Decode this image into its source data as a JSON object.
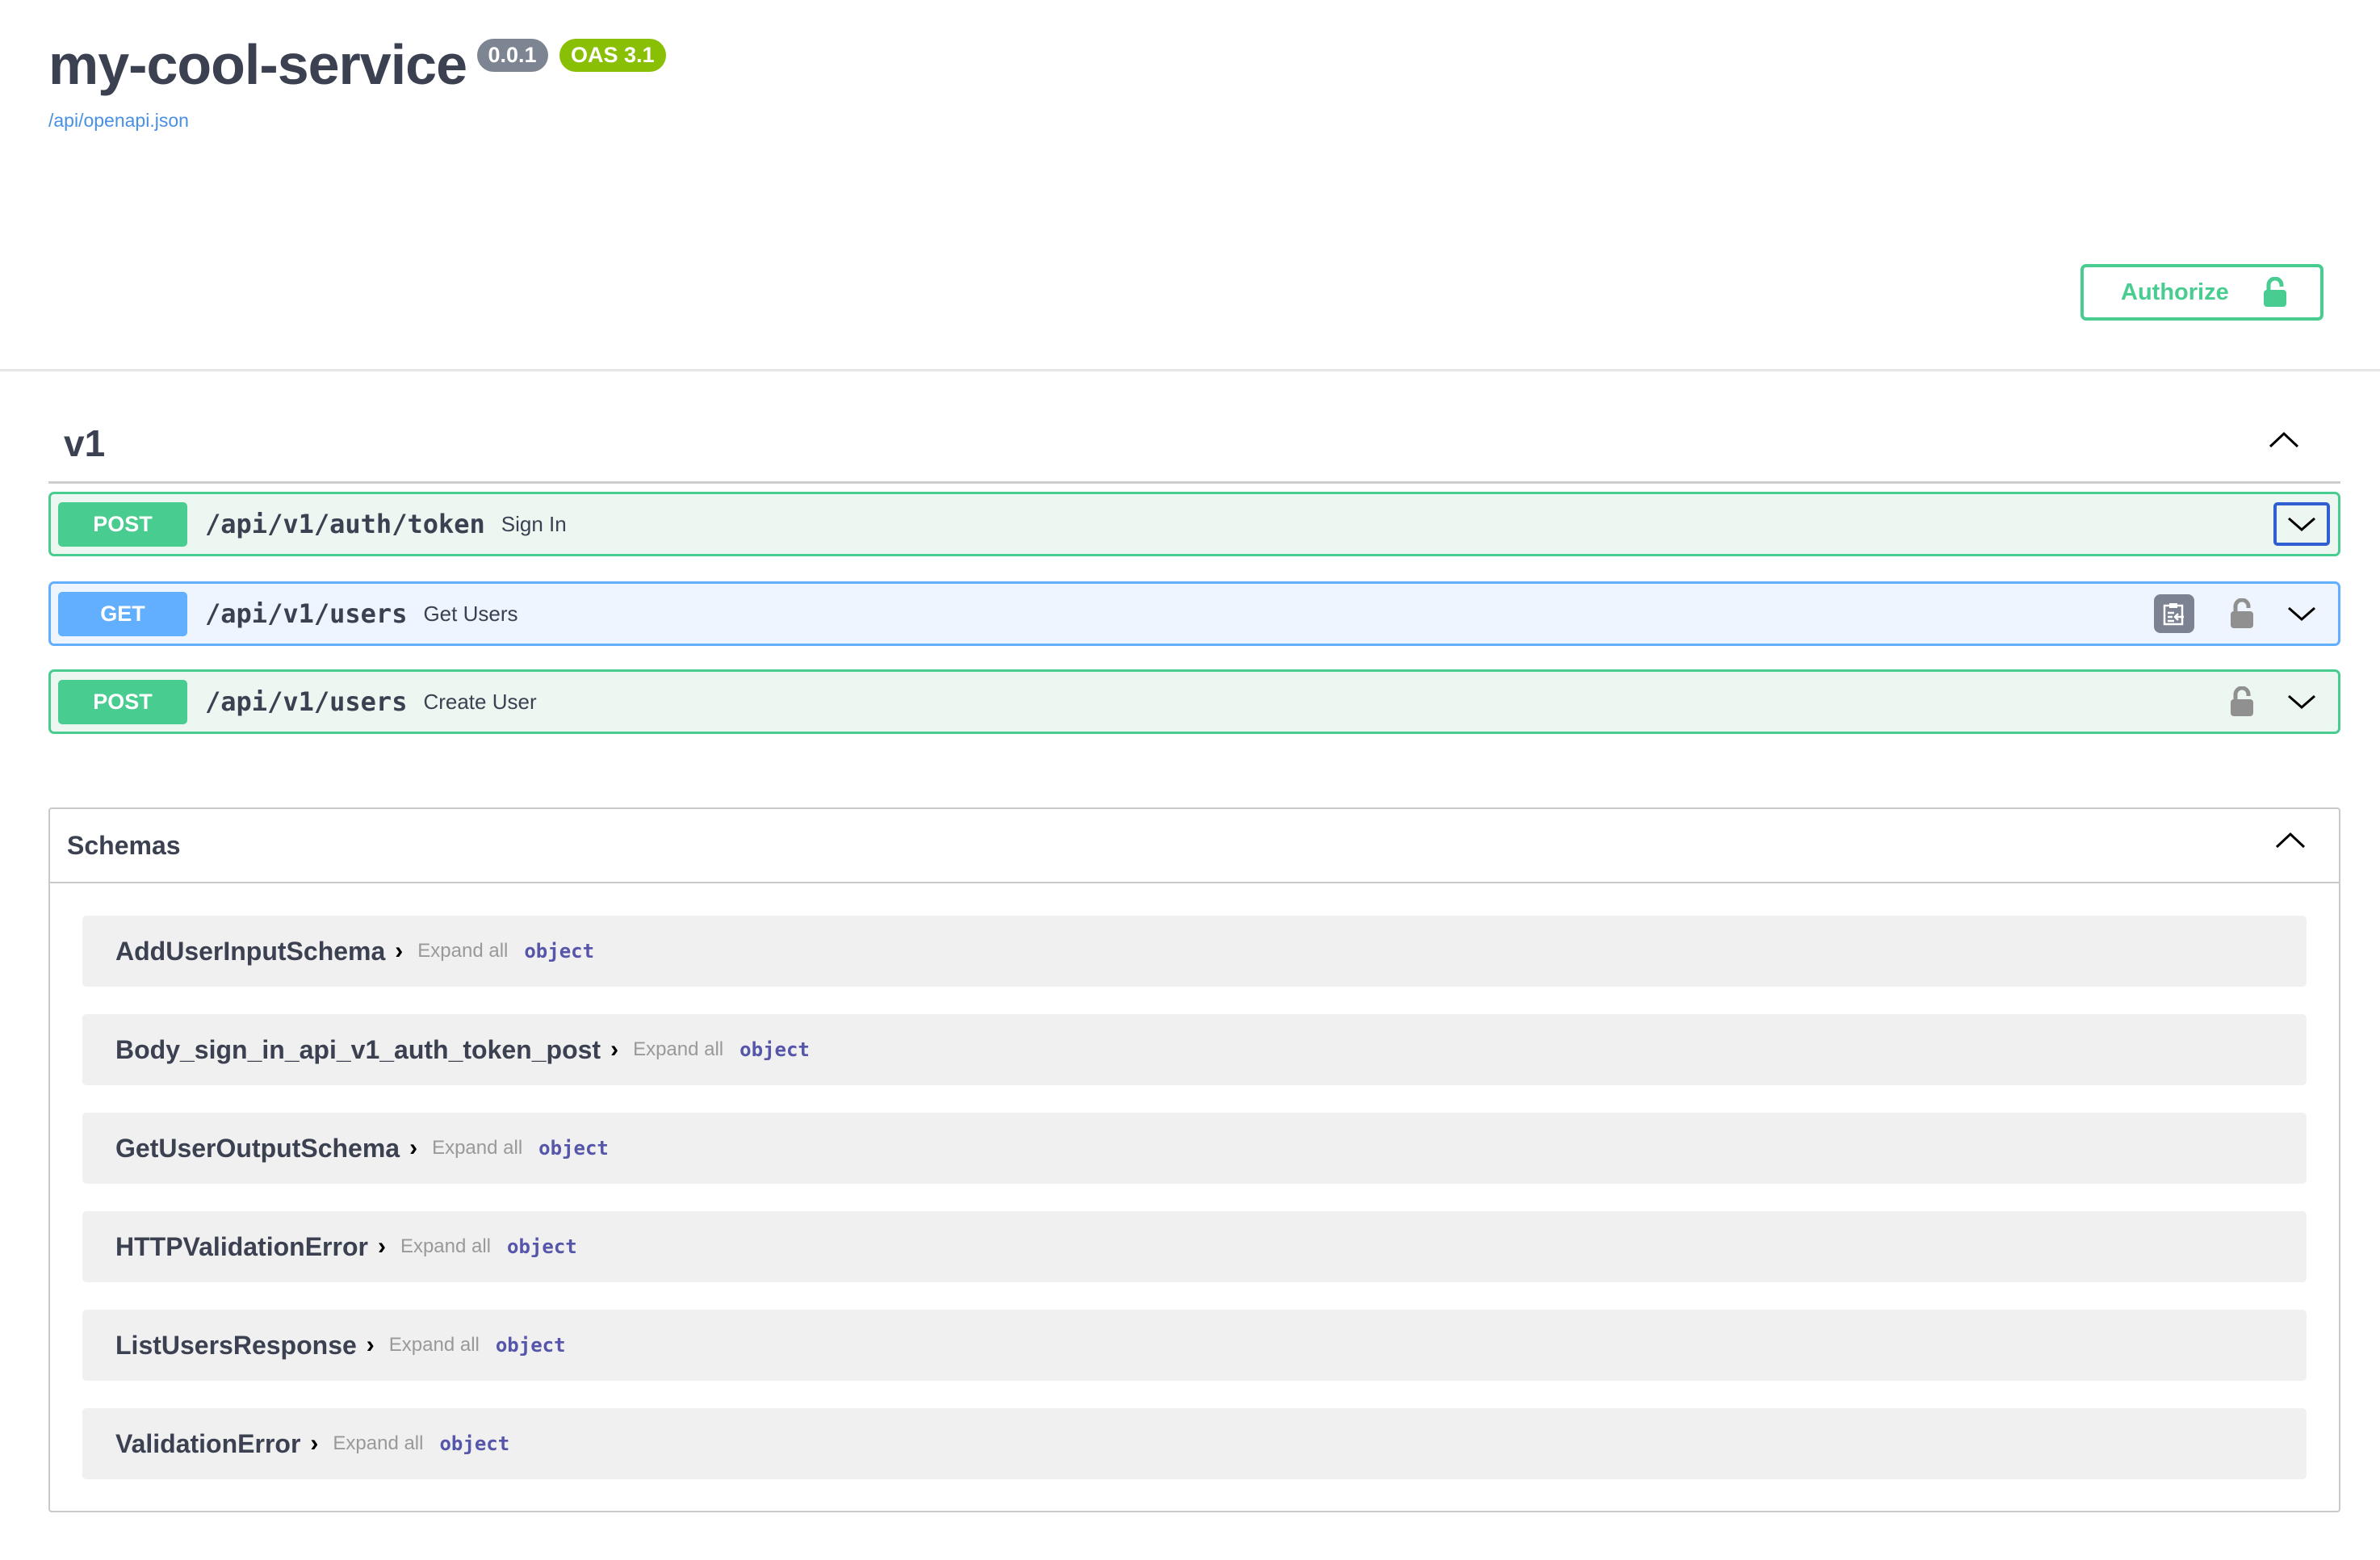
{
  "info": {
    "title": "my-cool-service",
    "version": "0.0.1",
    "oas": "OAS 3.1",
    "spec_link": "/api/openapi.json"
  },
  "colors": {
    "post": "#49cc90",
    "get": "#61affe",
    "version_badge": "#7d8492",
    "oas_badge": "#89bf04"
  },
  "authorize": {
    "label": "Authorize",
    "icon": "unlock-icon"
  },
  "tag": {
    "name": "v1",
    "expanded": true
  },
  "operations": [
    {
      "method": "POST",
      "path": "/api/v1/auth/token",
      "summary": "Sign In",
      "locked": false
    },
    {
      "method": "GET",
      "path": "/api/v1/users",
      "summary": "Get Users",
      "locked": true,
      "copy": true
    },
    {
      "method": "POST",
      "path": "/api/v1/users",
      "summary": "Create User",
      "locked": true
    }
  ],
  "schemas": {
    "title": "Schemas",
    "expand_label": "Expand all",
    "items": [
      {
        "name": "AddUserInputSchema",
        "type": "object"
      },
      {
        "name": "Body_sign_in_api_v1_auth_token_post",
        "type": "object"
      },
      {
        "name": "GetUserOutputSchema",
        "type": "object"
      },
      {
        "name": "HTTPValidationError",
        "type": "object"
      },
      {
        "name": "ListUsersResponse",
        "type": "object"
      },
      {
        "name": "ValidationError",
        "type": "object"
      }
    ]
  }
}
